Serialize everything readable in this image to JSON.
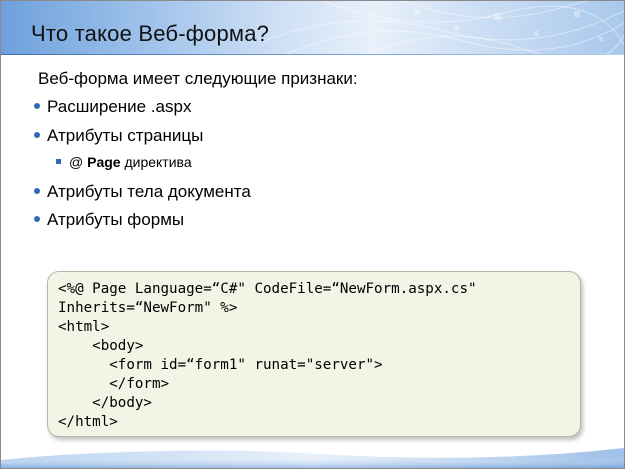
{
  "slide": {
    "title": "Что такое Веб-форма?",
    "intro": "Веб-форма имеет следующие признаки:",
    "bullets": [
      "Расширение .aspx",
      "Атрибуты страницы",
      "Атрибуты тела документа",
      "Атрибуты формы"
    ],
    "sub_bullet": {
      "prefix": "@ ",
      "bold": "Page",
      "suffix": " директива"
    },
    "code_lines": [
      "<%@ Page Language=“C#\" CodeFile=“NewForm.aspx.cs\"",
      "Inherits=“NewForm\" %>",
      "<html>",
      "    <body>",
      "      <form id=“form1\" runat=\"server\">",
      "      </form>",
      "    </body>",
      "</html>"
    ]
  },
  "colors": {
    "title_gradient_start": "#6ea0dc",
    "bullet": "#2f6bb5",
    "code_background": "#f3f3e6"
  }
}
